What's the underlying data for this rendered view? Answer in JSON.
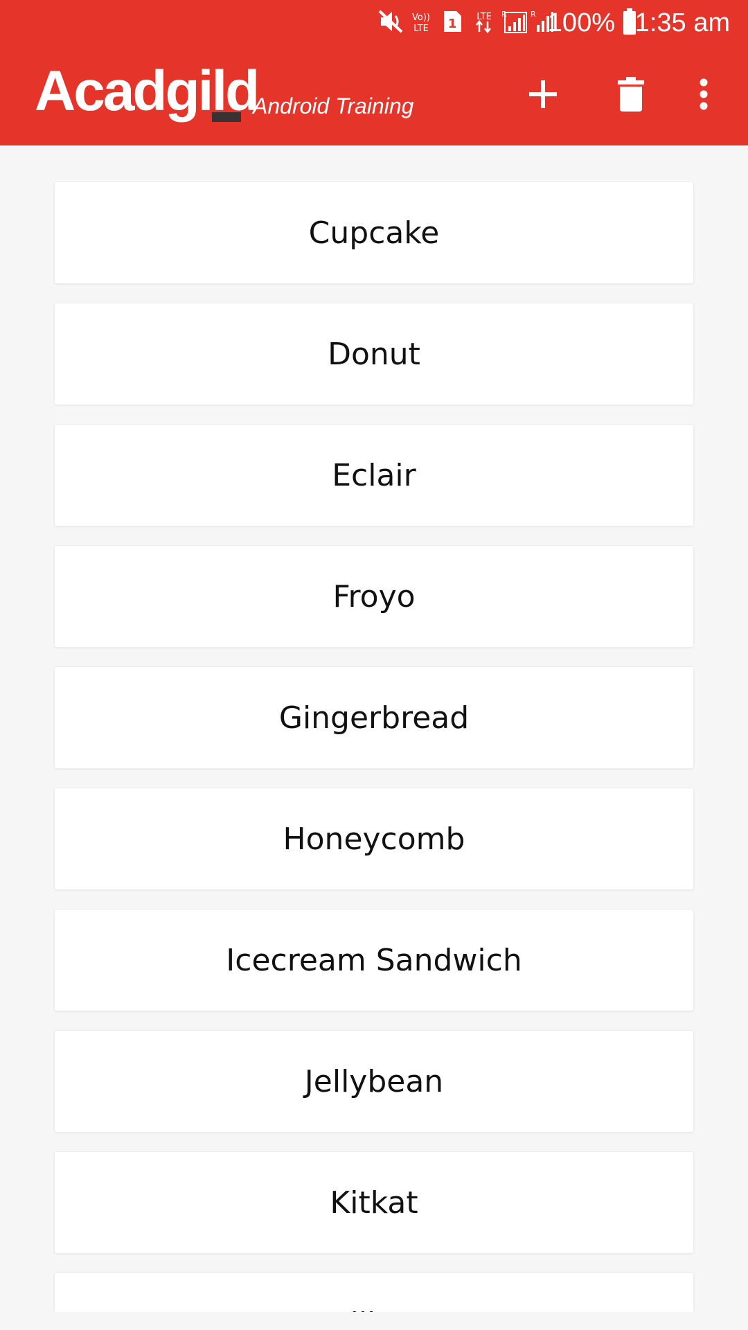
{
  "colors": {
    "app_bar": "#e5352b",
    "background": "#f7f6f7",
    "card": "#ffffff",
    "text": "#111111",
    "logo_accent": "#3a3232"
  },
  "status_bar": {
    "icons": [
      "mute-icon",
      "volte-icon",
      "sim1-icon",
      "lte-data-icon",
      "signal-roaming-icon",
      "signal-icon",
      "battery-icon"
    ],
    "battery": "100%",
    "time": "1:35 am"
  },
  "toolbar": {
    "logo": "Acadgild",
    "subtitle": "Android Training",
    "actions": [
      "add-icon",
      "delete-icon",
      "more-vert-icon"
    ]
  },
  "list": {
    "items": [
      "Cupcake",
      "Donut",
      "Eclair",
      "Froyo",
      "Gingerbread",
      "Honeycomb",
      "Icecream Sandwich",
      "Jellybean",
      "Kitkat",
      "Lollipop"
    ]
  }
}
